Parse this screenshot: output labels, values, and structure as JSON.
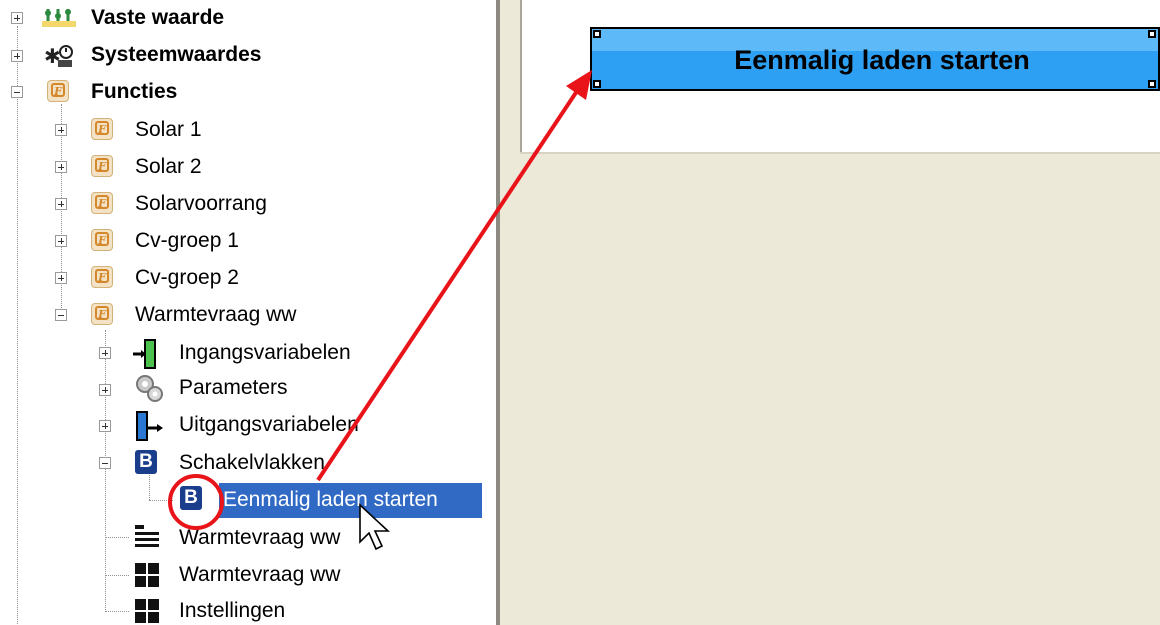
{
  "tree": {
    "items": [
      {
        "label": "Vaste waarde",
        "bold": true,
        "expander": "plus"
      },
      {
        "label": "Systeemwaardes",
        "bold": true,
        "expander": "plus"
      },
      {
        "label": "Functies",
        "bold": true,
        "expander": "minus"
      },
      {
        "label": "Solar 1",
        "expander": "plus"
      },
      {
        "label": "Solar 2",
        "expander": "plus"
      },
      {
        "label": "Solarvoorrang",
        "expander": "plus"
      },
      {
        "label": "Cv-groep 1",
        "expander": "plus"
      },
      {
        "label": "Cv-groep 2",
        "expander": "plus"
      },
      {
        "label": "Warmtevraag ww",
        "expander": "minus"
      },
      {
        "label": "Ingangsvariabelen",
        "expander": "plus"
      },
      {
        "label": "Parameters",
        "expander": "plus"
      },
      {
        "label": "Uitgangsvariabelen",
        "expander": "plus"
      },
      {
        "label": "Schakelvlakken",
        "expander": "minus"
      },
      {
        "label": "Eenmalig laden starten",
        "selected": true
      },
      {
        "label": "Warmtevraag ww"
      },
      {
        "label": "Warmtevraag ww"
      },
      {
        "label": "Instellingen"
      }
    ]
  },
  "canvas": {
    "button_label": "Eenmalig laden starten"
  },
  "colors": {
    "selection": "#316ac5",
    "button": "#2ea0f3",
    "arrow": "#e8141a",
    "canvas_bg": "#ece9d8"
  }
}
